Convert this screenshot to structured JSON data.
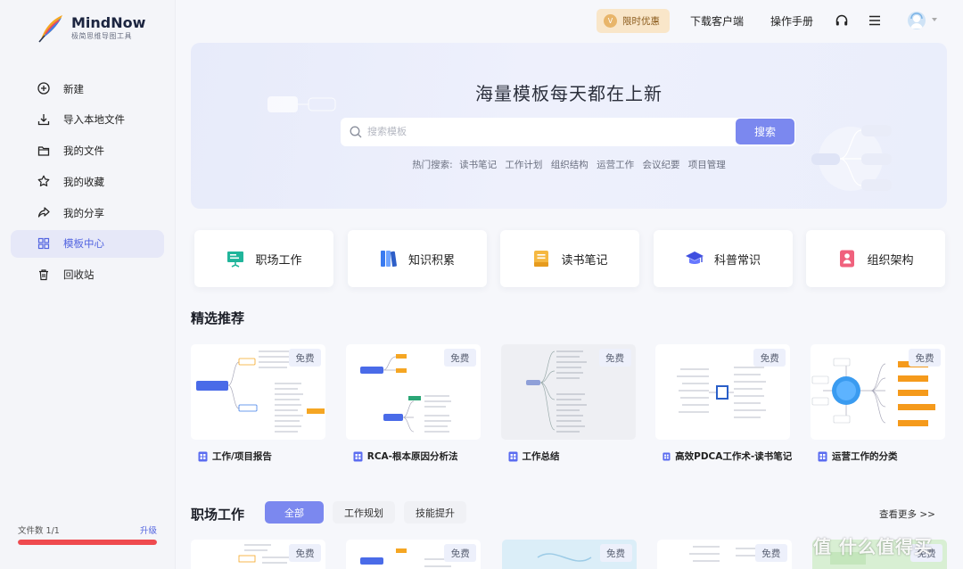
{
  "brand": {
    "name": "MindNow",
    "subtitle": "极简思维导图工具"
  },
  "sidebar": {
    "items": [
      {
        "label": "新建",
        "icon": "plus-circle-icon",
        "active": false
      },
      {
        "label": "导入本地文件",
        "icon": "download-icon",
        "active": false
      },
      {
        "label": "我的文件",
        "icon": "folder-icon",
        "active": false
      },
      {
        "label": "我的收藏",
        "icon": "star-icon",
        "active": false
      },
      {
        "label": "我的分享",
        "icon": "share-icon",
        "active": false
      },
      {
        "label": "模板中心",
        "icon": "grid-icon",
        "active": true
      },
      {
        "label": "回收站",
        "icon": "trash-icon",
        "active": false
      }
    ],
    "file_count_label": "文件数 1/1",
    "upgrade_label": "升级",
    "usage_fraction": 1.0
  },
  "header": {
    "promo_label": "限时优惠",
    "download_label": "下载客户端",
    "manual_label": "操作手册"
  },
  "banner": {
    "title": "海量模板每天都在上新",
    "search_placeholder": "搜索模板",
    "search_button": "搜索",
    "hot_label": "热门搜索:",
    "hot_terms": [
      "读书笔记",
      "工作计划",
      "组织结构",
      "运营工作",
      "会议纪要",
      "项目管理"
    ]
  },
  "categories": [
    {
      "label": "职场工作",
      "icon": "presentation-icon"
    },
    {
      "label": "知识积累",
      "icon": "books-icon"
    },
    {
      "label": "读书笔记",
      "icon": "notebook-icon"
    },
    {
      "label": "科普常识",
      "icon": "graduation-cap-icon"
    },
    {
      "label": "组织架构",
      "icon": "org-chart-icon"
    }
  ],
  "featured": {
    "title": "精选推荐",
    "badge": "免费",
    "cards": [
      {
        "name": "工作/项目报告"
      },
      {
        "name": "RCA-根本原因分析法"
      },
      {
        "name": "工作总结"
      },
      {
        "name": "高效PDCA工作术-读书笔记"
      },
      {
        "name": "运营工作的分类"
      }
    ]
  },
  "workplace": {
    "title": "职场工作",
    "tabs": [
      "全部",
      "工作规划",
      "技能提升"
    ],
    "more_label": "查看更多 >>"
  },
  "watermark": "值 什么值得买",
  "colors": {
    "accent": "#7b88ef",
    "active_nav_bg": "#e6e8f8",
    "progress": "#ef4a4f",
    "promo_bg": "#f9e6c9"
  }
}
